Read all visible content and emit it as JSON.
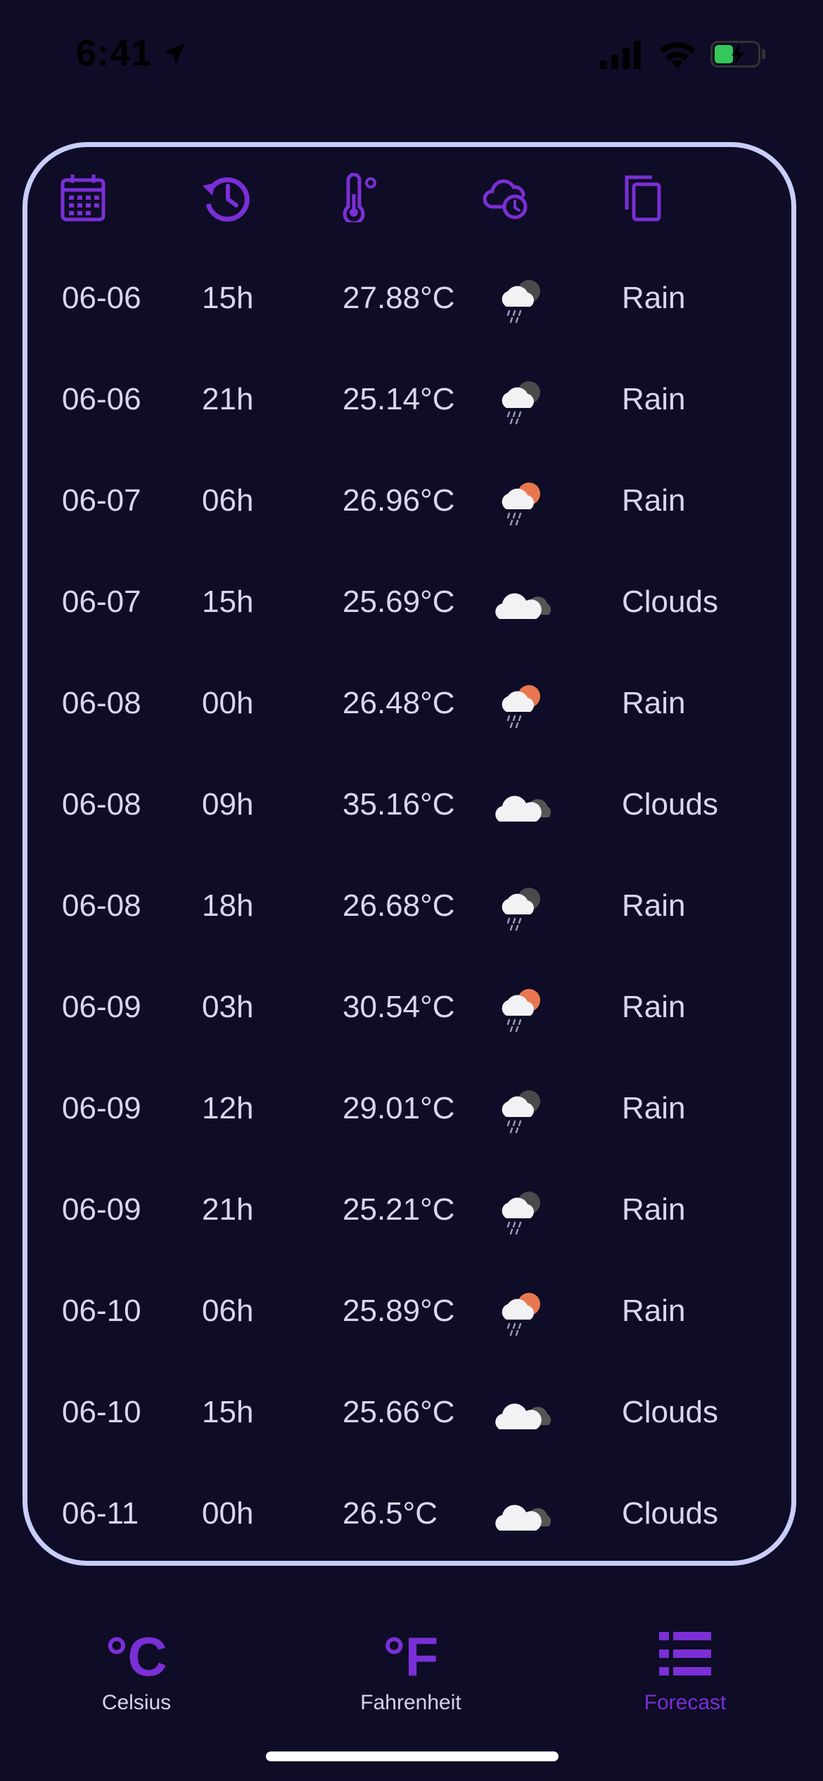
{
  "status": {
    "time": "6:41"
  },
  "header_icons": [
    "calendar-icon",
    "history-icon",
    "thermometer-icon",
    "cloud-clock-icon",
    "copy-icon"
  ],
  "forecast": [
    {
      "date": "06-06",
      "hour": "15h",
      "temp": "27.88°C",
      "icon": "rain-cloud-night-icon",
      "desc": "Rain"
    },
    {
      "date": "06-06",
      "hour": "21h",
      "temp": "25.14°C",
      "icon": "rain-cloud-night-icon",
      "desc": "Rain"
    },
    {
      "date": "06-07",
      "hour": "06h",
      "temp": "26.96°C",
      "icon": "rain-cloud-sun-icon",
      "desc": "Rain"
    },
    {
      "date": "06-07",
      "hour": "15h",
      "temp": "25.69°C",
      "icon": "clouds-icon",
      "desc": "Clouds"
    },
    {
      "date": "06-08",
      "hour": "00h",
      "temp": "26.48°C",
      "icon": "rain-cloud-sun-icon",
      "desc": "Rain"
    },
    {
      "date": "06-08",
      "hour": "09h",
      "temp": "35.16°C",
      "icon": "clouds-icon",
      "desc": "Clouds"
    },
    {
      "date": "06-08",
      "hour": "18h",
      "temp": "26.68°C",
      "icon": "rain-cloud-night-icon",
      "desc": "Rain"
    },
    {
      "date": "06-09",
      "hour": "03h",
      "temp": "30.54°C",
      "icon": "rain-cloud-sun-icon",
      "desc": "Rain"
    },
    {
      "date": "06-09",
      "hour": "12h",
      "temp": "29.01°C",
      "icon": "rain-cloud-night-icon",
      "desc": "Rain"
    },
    {
      "date": "06-09",
      "hour": "21h",
      "temp": "25.21°C",
      "icon": "rain-cloud-night-icon",
      "desc": "Rain"
    },
    {
      "date": "06-10",
      "hour": "06h",
      "temp": "25.89°C",
      "icon": "rain-cloud-sun-icon",
      "desc": "Rain"
    },
    {
      "date": "06-10",
      "hour": "15h",
      "temp": "25.66°C",
      "icon": "clouds-icon",
      "desc": "Clouds"
    },
    {
      "date": "06-11",
      "hour": "00h",
      "temp": "26.5°C",
      "icon": "clouds-icon",
      "desc": "Clouds"
    }
  ],
  "tabs": [
    {
      "icon": "°C",
      "label": "Celsius",
      "active": false
    },
    {
      "icon": "°F",
      "label": "Fahrenheit",
      "active": false
    },
    {
      "icon": "forecast-list-icon",
      "label": "Forecast",
      "active": true
    }
  ],
  "colors": {
    "background": "#0e0c26",
    "accent": "#7b2fd6",
    "card_border": "#c9cdfa",
    "text": "#d9d6f0"
  }
}
